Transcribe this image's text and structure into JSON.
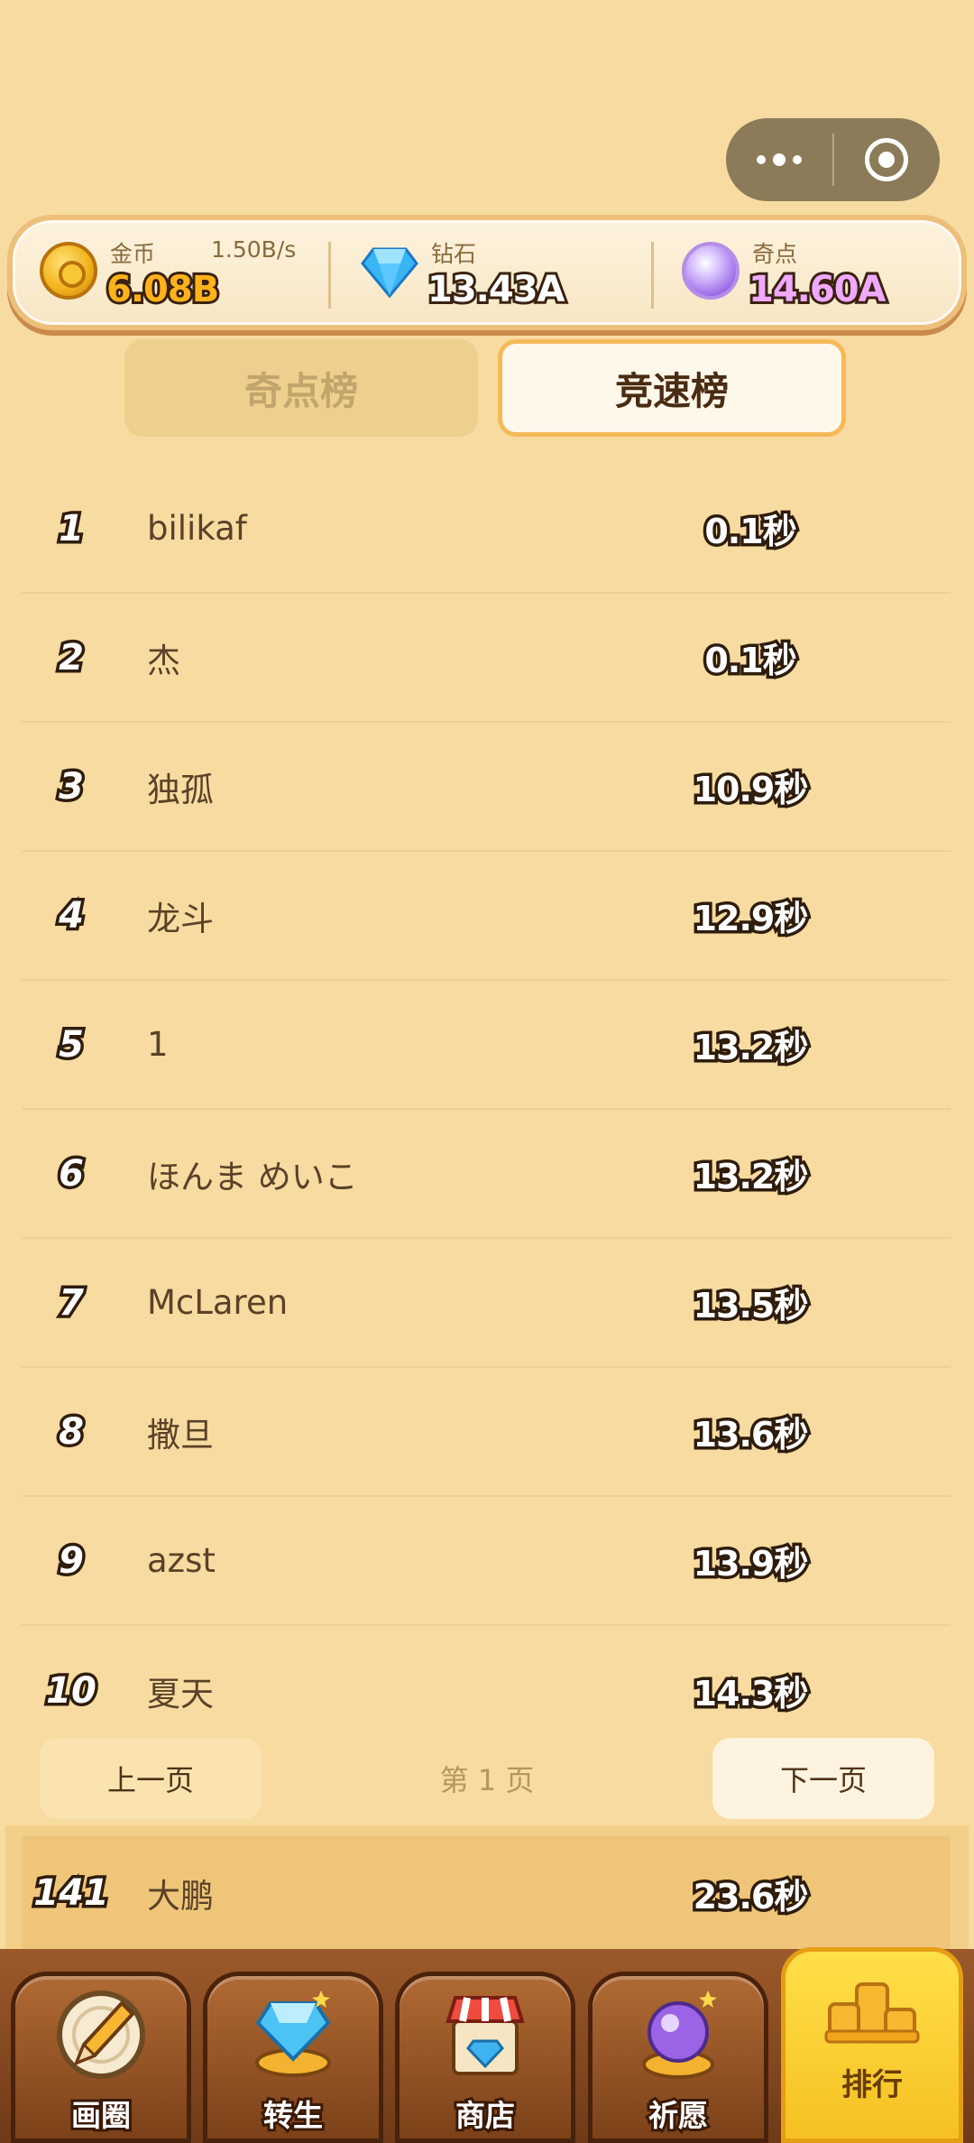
{
  "capsule": {
    "more_icon": "more-dots-icon",
    "close_icon": "target-icon"
  },
  "resources": {
    "gold": {
      "label": "金币",
      "rate": "1.50B/s",
      "value": "6.08B",
      "icon": "gold-coin-icon"
    },
    "diamond": {
      "label": "钻石",
      "value": "13.43A",
      "icon": "diamond-icon"
    },
    "qidian": {
      "label": "奇点",
      "value": "14.60A",
      "icon": "purple-orb-icon"
    }
  },
  "tabs": [
    {
      "label": "奇点榜",
      "active": false
    },
    {
      "label": "竞速榜",
      "active": true
    }
  ],
  "rankings": [
    {
      "rank": "1",
      "name": "bilikaf",
      "time": "0.1秒"
    },
    {
      "rank": "2",
      "name": "杰",
      "time": "0.1秒"
    },
    {
      "rank": "3",
      "name": "独孤",
      "time": "10.9秒"
    },
    {
      "rank": "4",
      "name": "龙斗",
      "time": "12.9秒"
    },
    {
      "rank": "5",
      "name": "1",
      "time": "13.2秒"
    },
    {
      "rank": "6",
      "name": "ほんま めいこ",
      "time": "13.2秒"
    },
    {
      "rank": "7",
      "name": "McLaren",
      "time": "13.5秒"
    },
    {
      "rank": "8",
      "name": "撒旦",
      "time": "13.6秒"
    },
    {
      "rank": "9",
      "name": "azst",
      "time": "13.9秒"
    },
    {
      "rank": "10",
      "name": "夏天",
      "time": "14.3秒"
    }
  ],
  "pagination": {
    "prev": "上一页",
    "page": "第 1 页",
    "next": "下一页"
  },
  "self": {
    "rank": "141",
    "name": "大鹏",
    "time": "23.6秒"
  },
  "nav": [
    {
      "label": "画圈",
      "icon": "pencil-circle-icon"
    },
    {
      "label": "转生",
      "icon": "diamond-pedestal-icon"
    },
    {
      "label": "商店",
      "icon": "shop-icon"
    },
    {
      "label": "祈愿",
      "icon": "crystal-ball-icon"
    },
    {
      "label": "排行",
      "icon": "podium-icon",
      "active": true
    }
  ]
}
